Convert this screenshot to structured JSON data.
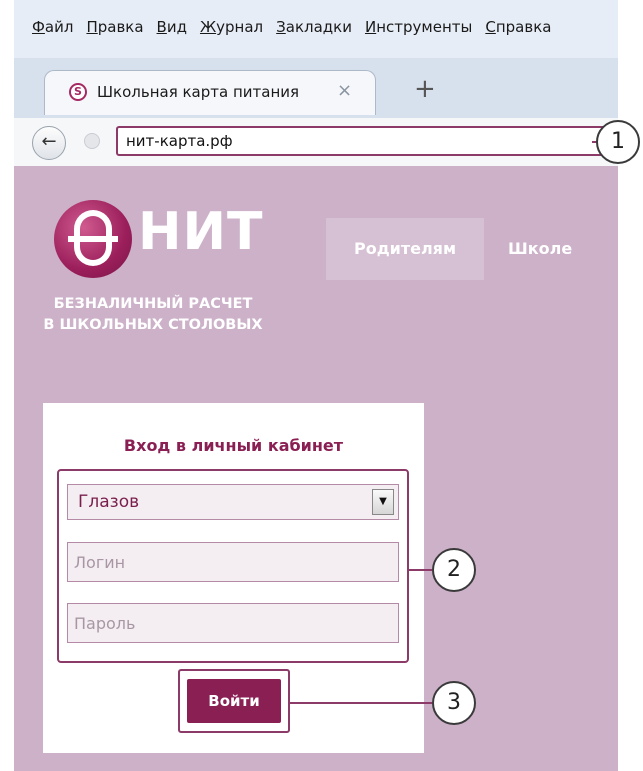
{
  "menubar": {
    "items": [
      {
        "label": "Файл",
        "accel": "Ф",
        "rest": "айл"
      },
      {
        "label": "Правка",
        "accel": "П",
        "rest": "равка"
      },
      {
        "label": "Вид",
        "accel": "В",
        "rest": "ид"
      },
      {
        "label": "Журнал",
        "accel": "Ж",
        "rest": "урнал"
      },
      {
        "label": "Закладки",
        "accel": "З",
        "rest": "акладки"
      },
      {
        "label": "Инструменты",
        "accel": "И",
        "rest": "нструменты"
      },
      {
        "label": "Справка",
        "accel": "С",
        "rest": "правка"
      }
    ]
  },
  "tab": {
    "title": "Школьная карта питания",
    "close_glyph": "×",
    "icon": "nit-logo-favicon"
  },
  "new_tab_glyph": "+",
  "navbar": {
    "back_glyph": "←",
    "url": "нит-карта.рф"
  },
  "site": {
    "logo_word": "НИТ",
    "tagline_line1": "БЕЗНАЛИЧНЫЙ РАСЧЕТ",
    "tagline_line2": "В ШКОЛЬНЫХ СТОЛОВЫХ",
    "nav": {
      "parents": "Родителям",
      "school": "Школе"
    }
  },
  "login": {
    "title": "Вход в личный кабинет",
    "city_selected": "Глазов",
    "select_arrow_glyph": "▼",
    "login_placeholder": "Логин",
    "password_placeholder": "Пароль",
    "submit_label": "Войти"
  },
  "callouts": [
    "1",
    "2",
    "3"
  ],
  "colors": {
    "brand": "#8a1f54",
    "page_bg": "#ccb1c9",
    "callout_stroke": "#8c3a68"
  }
}
